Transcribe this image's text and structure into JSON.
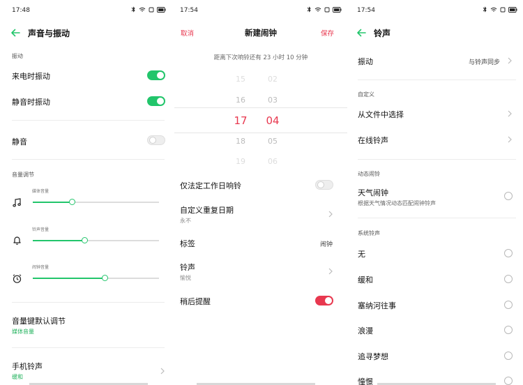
{
  "panel1": {
    "status_time": "17:48",
    "title": "声音与振动",
    "section_vibration": "振动",
    "vibrate_on_ring": "来电时振动",
    "vibrate_on_ring_on": true,
    "vibrate_on_silent": "静音时振动",
    "vibrate_on_silent_on": true,
    "silent": "静音",
    "silent_on": false,
    "section_volume": "音量调节",
    "volumes": [
      {
        "label": "媒体音量",
        "icon": "music-note-icon",
        "level": 0.31
      },
      {
        "label": "铃声音量",
        "icon": "bell-icon",
        "level": 0.41
      },
      {
        "label": "闹钟音量",
        "icon": "alarm-clock-icon",
        "level": 0.57
      }
    ],
    "volume_key_default": "音量键默认调节",
    "volume_key_default_value": "媒体音量",
    "phone_ringtone": "手机铃声",
    "phone_ringtone_value": "缓和",
    "accent": "#22c56b"
  },
  "panel2": {
    "status_time": "17:54",
    "cancel": "取消",
    "title": "新建闹钟",
    "save": "保存",
    "hint": "距离下次响铃还有  23 小时 10 分钟",
    "hours": [
      "15",
      "16",
      "17",
      "18",
      "19"
    ],
    "minutes": [
      "02",
      "03",
      "04",
      "05",
      "06"
    ],
    "workdays_only": "仅法定工作日响铃",
    "workdays_only_on": false,
    "custom_repeat": "自定义重复日期",
    "custom_repeat_value": "永不",
    "label": "标签",
    "label_value": "闹钟",
    "ringtone": "铃声",
    "ringtone_value": "愉悦",
    "snooze": "稍后提醒",
    "snooze_on": true,
    "accent": "#e8384f"
  },
  "panel3": {
    "status_time": "17:54",
    "title": "铃声",
    "vibration": "振动",
    "vibration_value": "与铃声同步",
    "section_custom": "自定义",
    "from_file": "从文件中选择",
    "online": "在线铃声",
    "section_dynamic": "动态闹铃",
    "weather_alarm": "天气闹钟",
    "weather_alarm_desc": "根据天气情况动态匹配闹钟铃声",
    "section_system": "系统铃声",
    "tones": [
      "无",
      "缓和",
      "塞纳河往事",
      "浪漫",
      "追寻梦想",
      "憧憬"
    ]
  }
}
